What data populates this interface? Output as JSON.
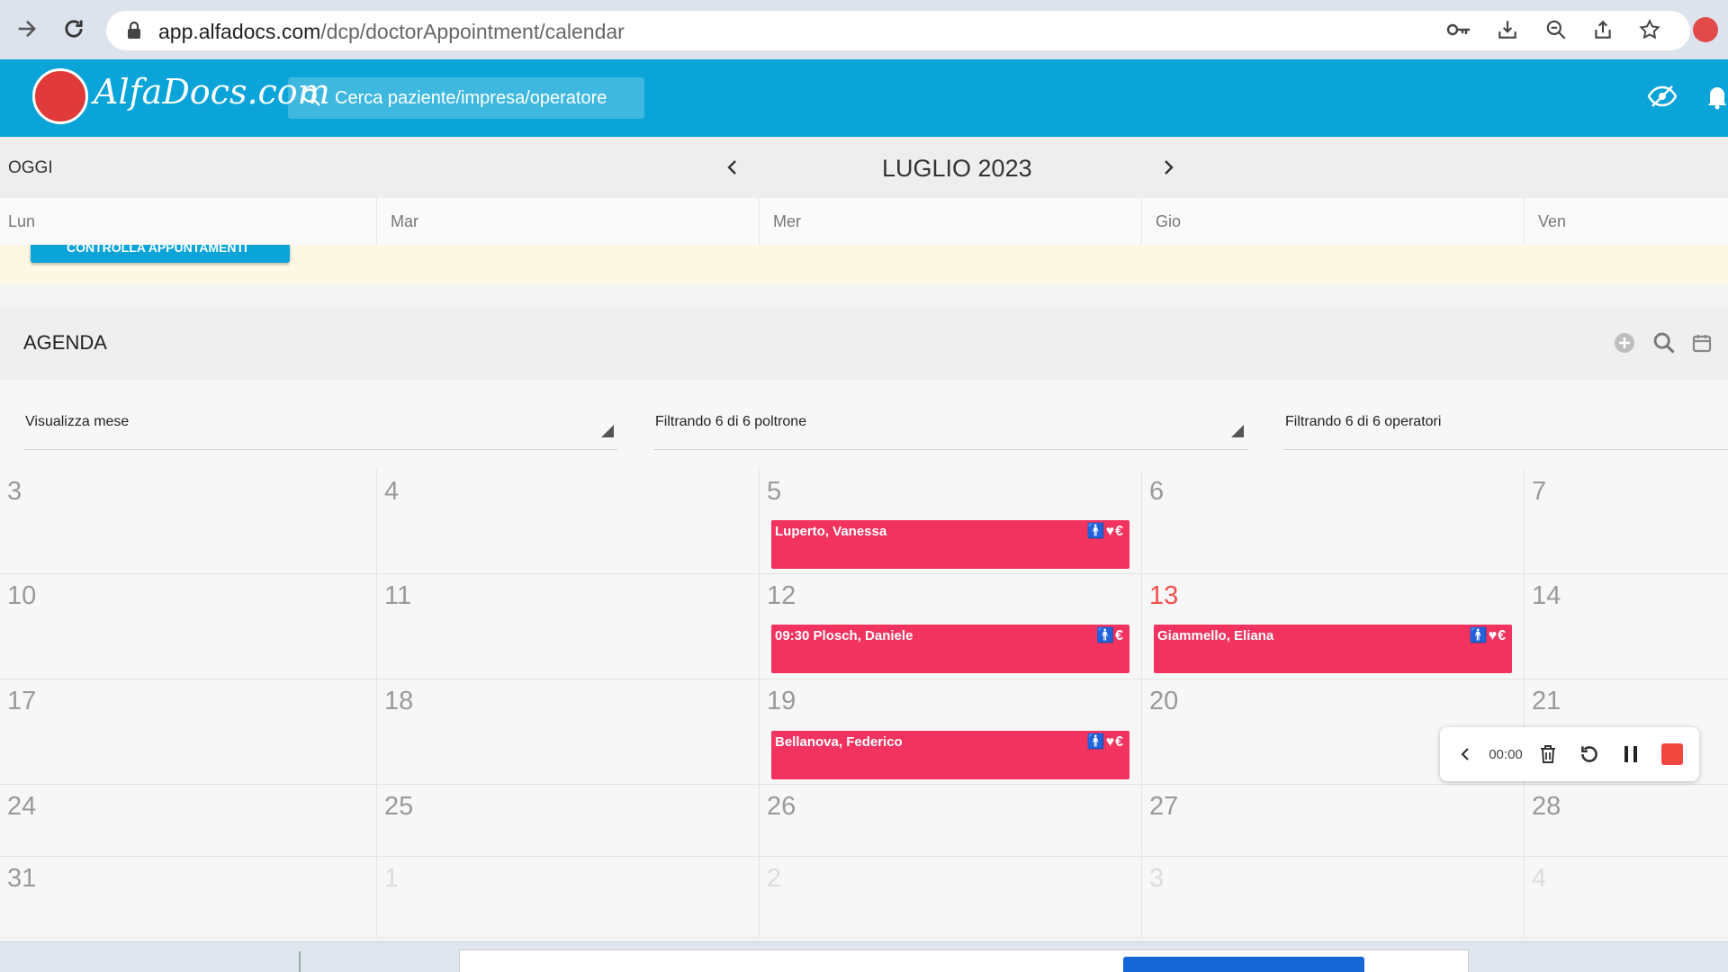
{
  "browser": {
    "url_host": "app.alfadocs.com",
    "url_path": "/dcp/doctorAppointment/calendar"
  },
  "app": {
    "logo_text": "AlfaDocs.com",
    "search_placeholder": "Cerca paziente/impresa/operatore"
  },
  "calendar": {
    "today_label": "OGGI",
    "month_title": "LUGLIO 2023",
    "weekdays": [
      "Lun",
      "Mar",
      "Mer",
      "Gio",
      "Ven"
    ],
    "banner_button": "CONTROLLA APPUNTAMENTI"
  },
  "agenda": {
    "title": "AGENDA",
    "filter_view": "Visualizza mese",
    "filter_chairs": "Filtrando 6 di 6 poltrone",
    "filter_operators": "Filtrando 6 di 6 operatori"
  },
  "weeks": [
    [
      "3",
      "4",
      "5",
      "6",
      "7"
    ],
    [
      "10",
      "11",
      "12",
      "13",
      "14"
    ],
    [
      "17",
      "18",
      "19",
      "20",
      "21"
    ],
    [
      "24",
      "25",
      "26",
      "27",
      "28"
    ],
    [
      "31",
      "1",
      "2",
      "3",
      "4"
    ]
  ],
  "today_day": "13",
  "events": {
    "e1": {
      "label": "Luperto, Vanessa",
      "icons": "🚹♥€"
    },
    "e2": {
      "label": "09:30 Plosch, Daniele",
      "icons": "🚹€"
    },
    "e3": {
      "label": "Giammello, Eliana",
      "icons": "🚹♥€"
    },
    "e4": {
      "label": "Bellanova, Federico",
      "icons": "🚹♥€"
    }
  },
  "recorder": {
    "time": "00:00"
  },
  "colors": {
    "header": "#0aa4d8",
    "event": "#f2325f",
    "today": "#f0504a"
  }
}
